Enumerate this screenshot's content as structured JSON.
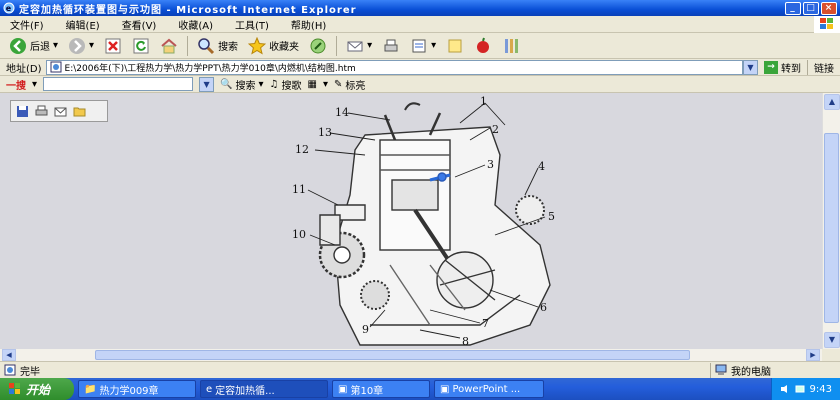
{
  "window": {
    "title": "定容加热循环装置图与示功图 - Microsoft Internet Explorer"
  },
  "menu": [
    "文件(F)",
    "编辑(E)",
    "查看(V)",
    "收藏(A)",
    "工具(T)",
    "帮助(H)"
  ],
  "toolbar": {
    "back_label": "后退",
    "search_label": "搜索",
    "favorites_label": "收藏夹"
  },
  "address": {
    "label": "地址(D)",
    "value": "E:\\2006年(下)\\工程热力学\\热力学PPT\\热力学010章\\内燃机\\结构图.htm",
    "go_label": "转到",
    "links_label": "链接"
  },
  "search_bar": {
    "brand": "一搜",
    "search_label": "搜索",
    "song_label": "搜歌",
    "mark_label": "标亮"
  },
  "diagram": {
    "labels": [
      "1",
      "2",
      "3",
      "4",
      "5",
      "6",
      "7",
      "8",
      "9",
      "10",
      "11",
      "12",
      "13",
      "14"
    ]
  },
  "status": {
    "left_text": "完毕",
    "zone_text": "我的电脑"
  },
  "taskbar": {
    "start_label": "开始",
    "tasks": [
      "热力学009章",
      "定容加热循...",
      "第10章",
      "PowerPoint ..."
    ],
    "clock": "9:43"
  },
  "colors": {
    "title_blue": "#0a4fd6",
    "taskbar_blue": "#245edb",
    "start_green": "#3a9a37",
    "tray_blue": "#0f8ff0"
  }
}
